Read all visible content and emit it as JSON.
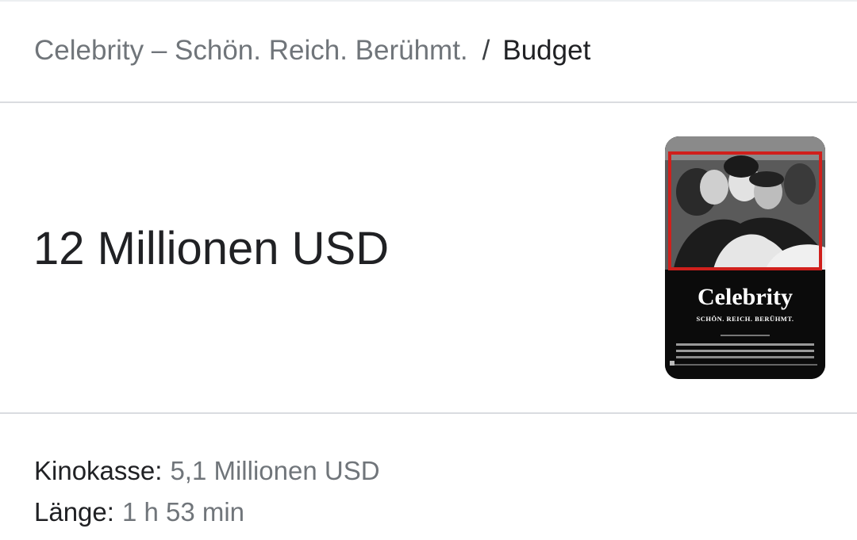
{
  "breadcrumb": {
    "parent": "Celebrity – Schön. Reich. Berühmt.",
    "separator": "/",
    "current": "Budget"
  },
  "answer": {
    "value": "12 Millionen USD"
  },
  "poster": {
    "icon": "movie-poster-image",
    "title": "Celebrity",
    "tagline": "SCHÖN. REICH. BERÜHMT.",
    "frame_color": "#d0201c",
    "background_color": "#0b0b0b"
  },
  "facts": [
    {
      "label": "Kinokasse:",
      "value": "5,1 Millionen USD"
    },
    {
      "label": "Länge:",
      "value": "1 h 53 min"
    }
  ],
  "colors": {
    "primary_text": "#202124",
    "secondary_text": "#70757a",
    "divider": "#dadce0"
  }
}
